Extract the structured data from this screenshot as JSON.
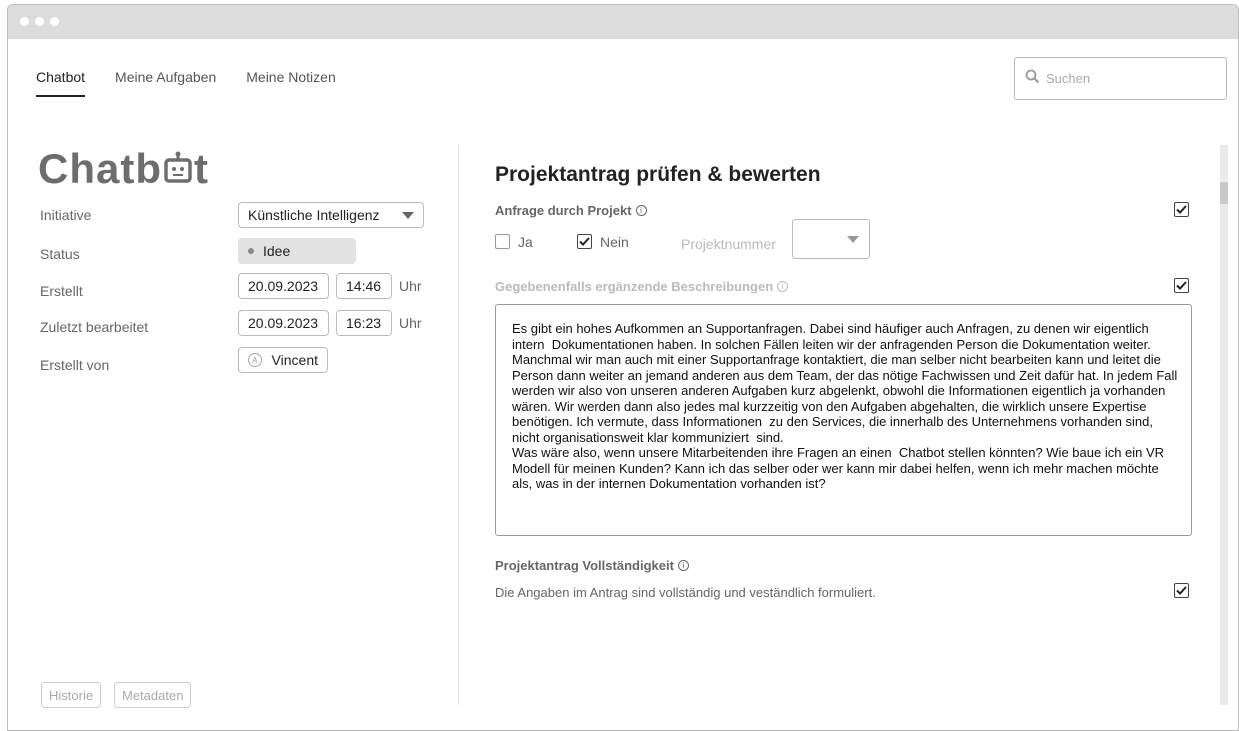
{
  "nav": {
    "tabs": [
      {
        "label": "Chatbot"
      },
      {
        "label": "Meine Aufgaben"
      },
      {
        "label": "Meine Notizen"
      }
    ]
  },
  "search": {
    "placeholder": "Suchen"
  },
  "logo": {
    "prefix": "Chatb",
    "suffix": "t"
  },
  "meta": {
    "initiative_label": "Initiative",
    "initiative_value": "Künstliche Intelligenz",
    "status_label": "Status",
    "status_value": "Idee",
    "created_label": "Erstellt",
    "created_date": "20.09.2023",
    "created_time": "14:46",
    "edited_label": "Zuletzt bearbeitet",
    "edited_date": "20.09.2023",
    "edited_time": "16:23",
    "unit": "Uhr",
    "author_label": "Erstellt von",
    "author_value": "Vincent",
    "author_initial": "A"
  },
  "footer": {
    "history": "Historie",
    "metadata": "Metadaten"
  },
  "main": {
    "title": "Projektantrag prüfen & bewerten",
    "request": {
      "label": "Anfrage durch Projekt",
      "checked": true,
      "option_yes": "Ja",
      "option_no": "Nein",
      "yes_checked": false,
      "no_checked": true,
      "project_number_label": "Projektnummer"
    },
    "description": {
      "label": "Gegebenenfalls ergänzende Beschreibungen",
      "checked": true,
      "text": "Es gibt ein hohes Aufkommen an Supportanfragen. Dabei sind häufiger auch Anfragen, zu denen wir eigentlich intern  Dokumentationen haben. In solchen Fällen leiten wir der anfragenden Person die Dokumentation weiter.  Manchmal wir man auch mit einer Supportanfrage kontaktiert, die man selber nicht bearbeiten kann und leitet die Person dann weiter an jemand anderen aus dem Team, der das nötige Fachwissen und Zeit dafür hat. In jedem Fall werden wir also von unseren anderen Aufgaben kurz abgelenkt, obwohl die Informationen eigentlich ja vorhanden wären. Wir werden dann also jedes mal kurzzeitig von den Aufgaben abgehalten, die wirklich unsere Expertise benötigen. Ich vermute, dass Informationen  zu den Services, die innerhalb des Unternehmens vorhanden sind,  nicht organisationsweit klar kommuniziert  sind.\nWas wäre also, wenn unsere Mitarbeitenden ihre Fragen an einen  Chatbot stellen könnten? Wie baue ich ein VR Modell für meinen Kunden? Kann ich das selber oder wer kann mir dabei helfen, wenn ich mehr machen möchte als, was in der internen Dokumentation vorhanden ist?"
    },
    "completeness": {
      "label": "Projektantrag Vollständigkeit",
      "text": "Die Angaben im Antrag sind vollständig und veständlich formuliert.",
      "checked": true
    }
  },
  "colors": {
    "accent": "#222222",
    "muted": "#666666",
    "light": "#bbbbbb",
    "titlebar": "#dcdcdc"
  }
}
